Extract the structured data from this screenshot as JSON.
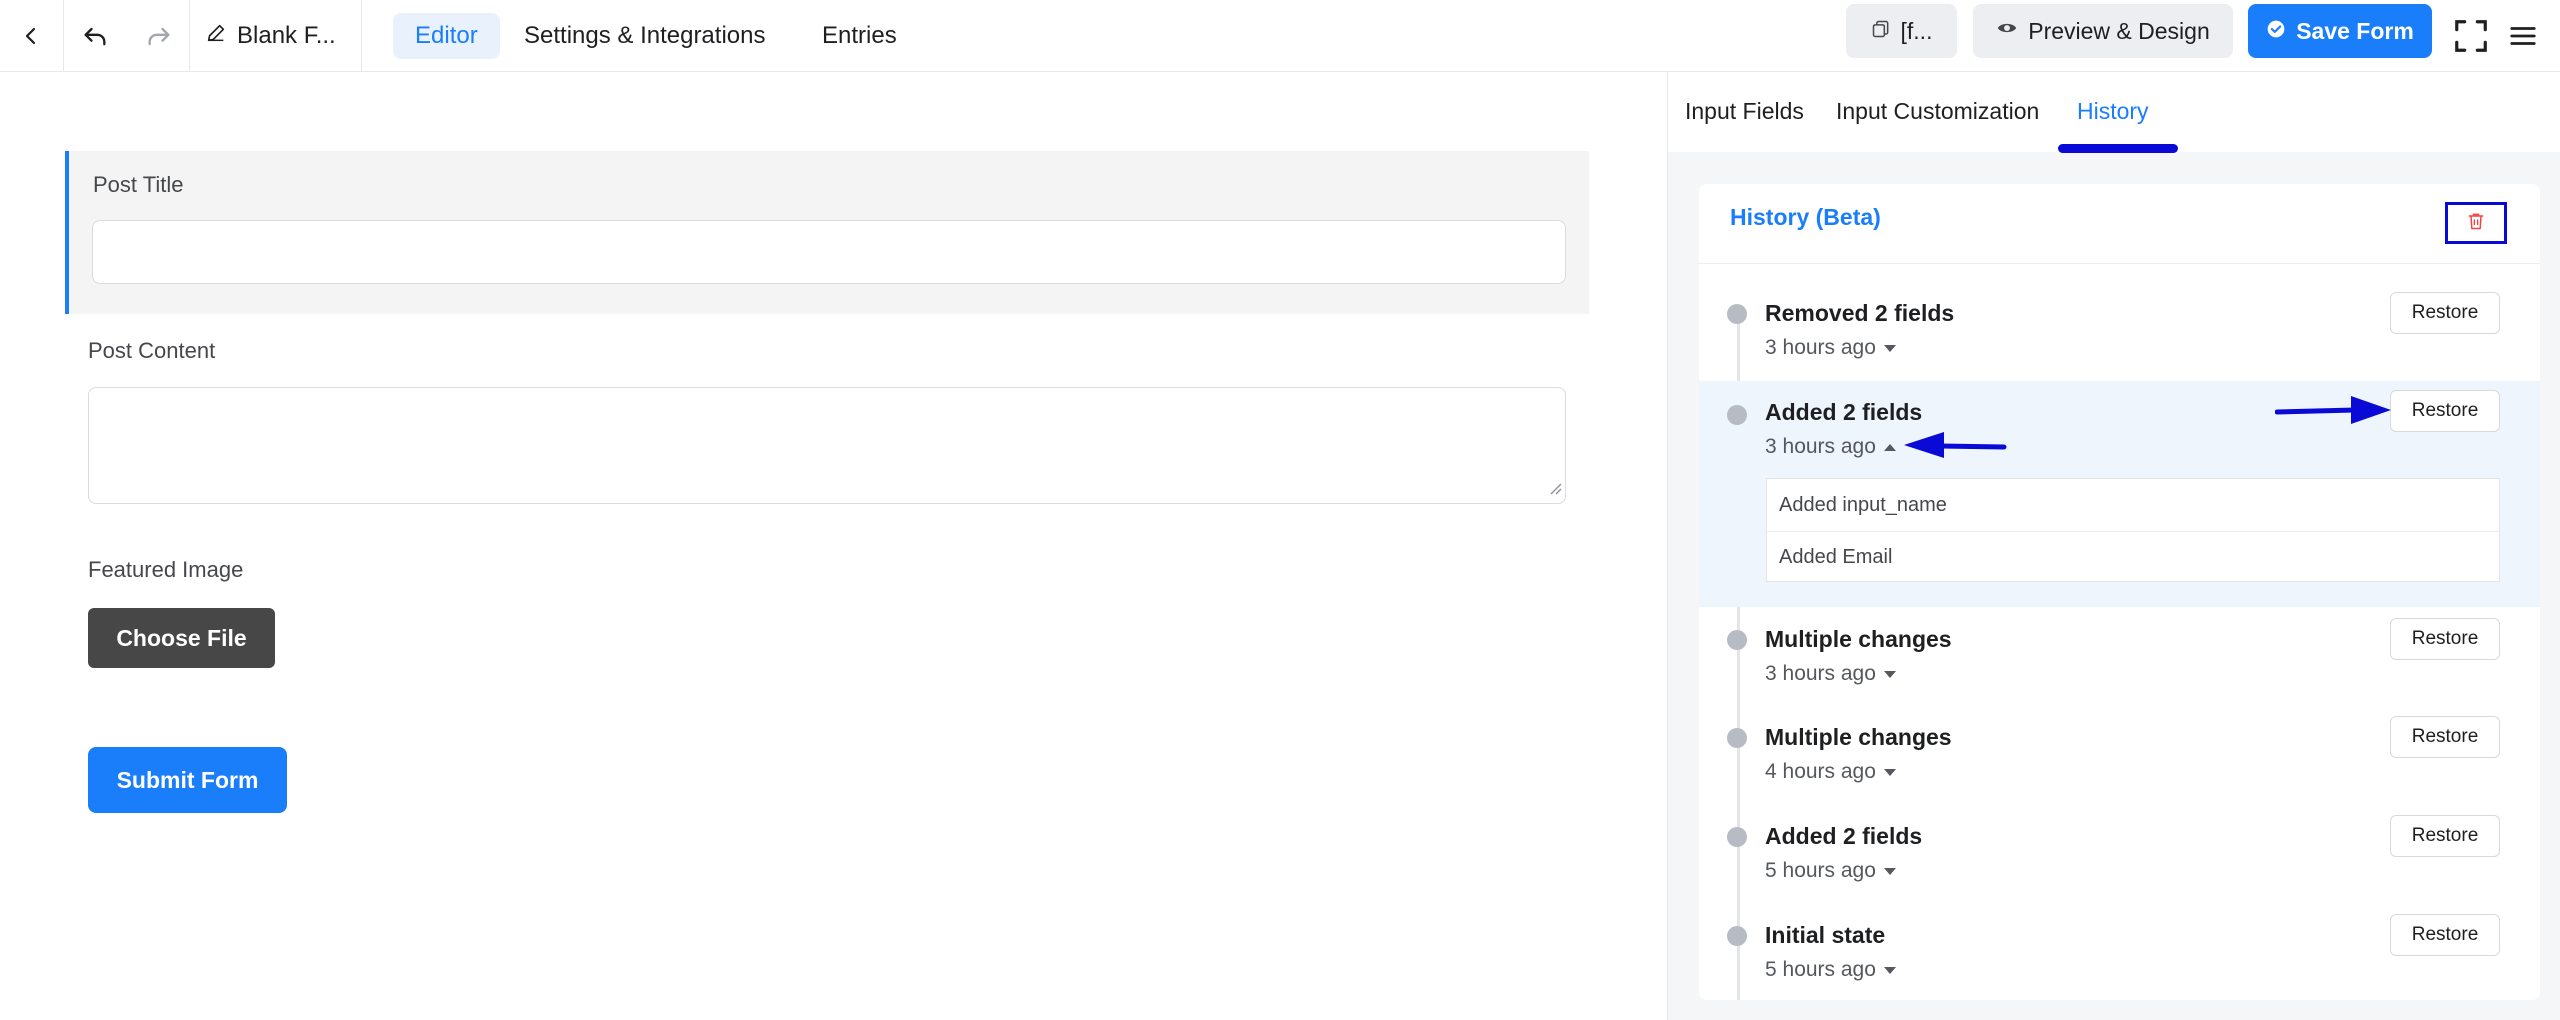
{
  "topbar": {
    "form_title": "Blank F...",
    "tabs": [
      {
        "label": "Editor"
      },
      {
        "label": "Settings & Integrations"
      },
      {
        "label": "Entries"
      }
    ],
    "shortcode_label": "[f...",
    "preview_label": "Preview & Design",
    "save_label": "Save Form"
  },
  "form": {
    "post_title_label": "Post Title",
    "post_content_label": "Post Content",
    "featured_image_label": "Featured Image",
    "choose_file_label": "Choose File",
    "submit_label": "Submit Form"
  },
  "panel": {
    "tabs": [
      {
        "label": "Input Fields"
      },
      {
        "label": "Input Customization"
      },
      {
        "label": "History"
      }
    ],
    "active_tab": "History",
    "history_title": "History (Beta)",
    "restore_label": "Restore",
    "items": [
      {
        "title": "Removed 2 fields",
        "time": "3 hours ago",
        "expanded": false
      },
      {
        "title": "Added 2 fields",
        "time": "3 hours ago",
        "expanded": true,
        "changes": [
          "Added input_name",
          "Added Email"
        ]
      },
      {
        "title": "Multiple changes",
        "time": "3 hours ago",
        "expanded": false
      },
      {
        "title": "Multiple changes",
        "time": "4 hours ago",
        "expanded": false
      },
      {
        "title": "Added 2 fields",
        "time": "5 hours ago",
        "expanded": false
      },
      {
        "title": "Initial state",
        "time": "5 hours ago",
        "expanded": false
      }
    ]
  },
  "colors": {
    "accent": "#1a7efb",
    "annotation": "#0a0ad6",
    "danger": "#ef4444"
  }
}
